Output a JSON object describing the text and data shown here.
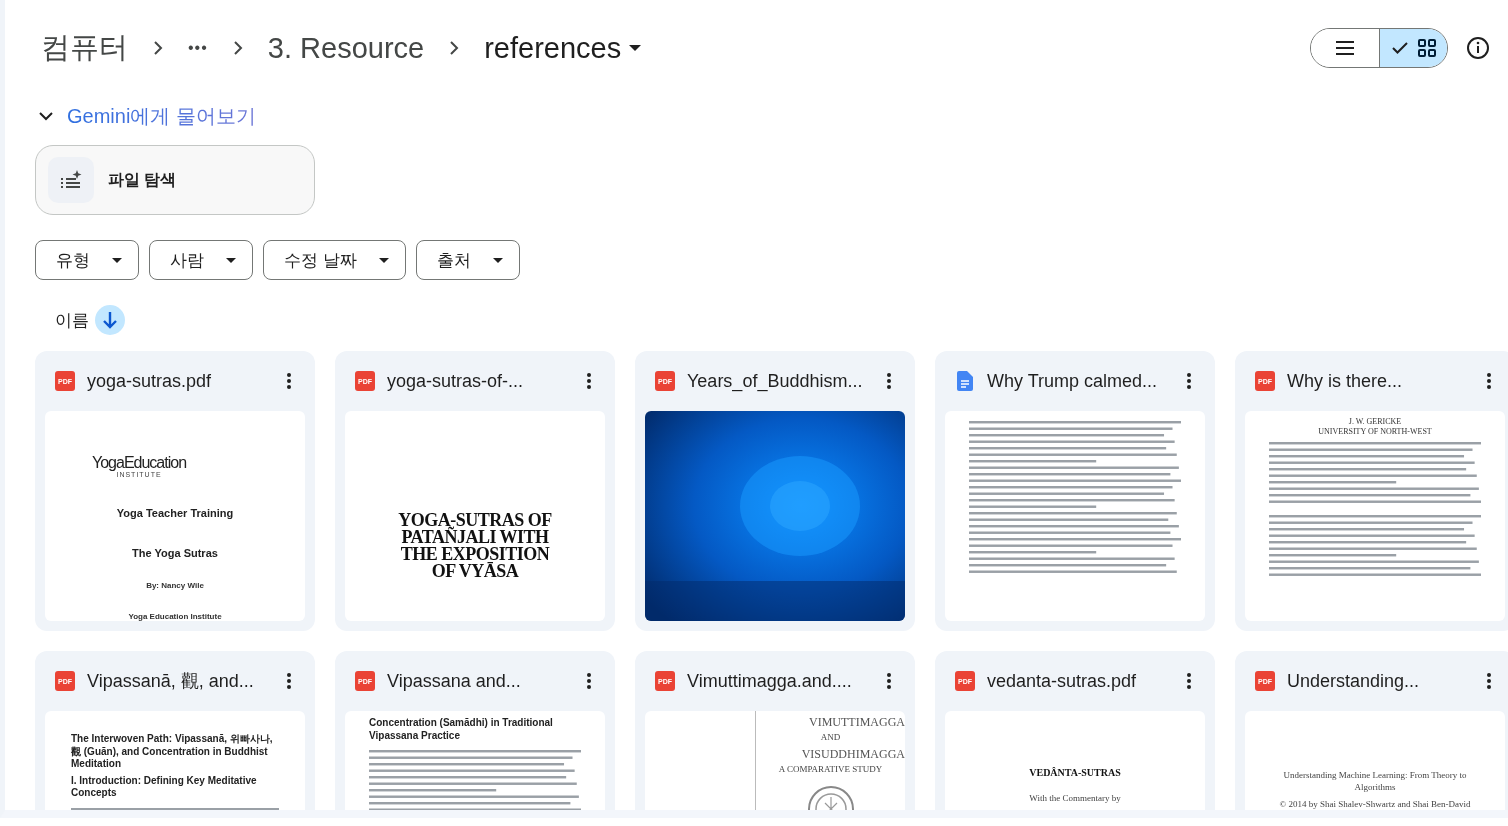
{
  "breadcrumb": [
    {
      "kind": "root",
      "label": "컴퓨터"
    },
    {
      "kind": "more",
      "label": "•••"
    },
    {
      "kind": "folder",
      "label": "3. Resource"
    },
    {
      "kind": "current",
      "label": "references"
    }
  ],
  "view_toggle": [
    {
      "kind": "list",
      "selected": false
    },
    {
      "kind": "grid",
      "selected": true
    }
  ],
  "gemini": {
    "label": "Gemini에게 물어보기",
    "expanded": true,
    "action": "파일 탐색"
  },
  "filters": [
    "유형",
    "사람",
    "수정 날짜",
    "출처"
  ],
  "sort": {
    "label": "이름",
    "descending": true
  },
  "files": [
    {
      "name": "yoga-sutras.pdf",
      "kind": "pdf",
      "type_label": "PDF",
      "preview": {
        "kind": "spread",
        "blocks": [
          {
            "kind": "logo",
            "text": "YogaEducation",
            "sub": "INSTITUTE"
          },
          {
            "kind": "subtitle",
            "text": "Yoga Teacher Training"
          },
          {
            "kind": "subtitle",
            "text": "The Yoga Sutras"
          },
          {
            "kind": "byline",
            "text": "By: Nancy Wile"
          },
          {
            "kind": "byline",
            "text": "Yoga Education Institute"
          }
        ]
      }
    },
    {
      "name": "yoga-sutras-of-...",
      "kind": "pdf",
      "type_label": "PDF",
      "preview": {
        "kind": "middle",
        "blocks": [
          {
            "kind": "serif_title",
            "text": "YOGA-SUTRAS OF PATAÑJALI WITH THE EXPOSITION OF VYĀSA"
          }
        ]
      }
    },
    {
      "name": "Years_of_Buddhism...",
      "kind": "pdf",
      "type_label": "PDF"
    },
    {
      "name": "Why Trump calmed...",
      "kind": "doc",
      "preview": {
        "kind": "top",
        "blocks": [
          {
            "kind": "long_text"
          }
        ]
      }
    },
    {
      "name": "Why is there...",
      "kind": "pdf",
      "type_label": "PDF",
      "preview": {
        "kind": "top",
        "blocks": [
          {
            "kind": "caps",
            "text": "J. W. GERICKE"
          },
          {
            "kind": "caps",
            "text": "UNIVERSITY OF NORTH-WEST"
          },
          {
            "kind": "paragraph"
          },
          {
            "kind": "paragraph"
          }
        ]
      }
    },
    {
      "name": "Vipassanā, 觀, and...",
      "kind": "pdf",
      "type_label": "PDF",
      "preview": {
        "kind": "mid_top",
        "blocks": [
          {
            "kind": "heading",
            "text": "The Interwoven Path: Vipassanā, 위빠사나, 觀 (Guān), and Concentration in Buddhist Meditation"
          },
          {
            "kind": "heading",
            "text": "I. Introduction: Defining Key Meditative Concepts"
          },
          {
            "kind": "paragraph"
          }
        ]
      }
    },
    {
      "name": "Vipassana and...",
      "kind": "pdf",
      "type_label": "PDF",
      "preview": {
        "kind": "top",
        "blocks": [
          {
            "kind": "heading",
            "text": "Concentration (Samādhi) in Traditional Vipassana Practice"
          },
          {
            "kind": "paragraph"
          }
        ]
      }
    },
    {
      "name": "Vimuttimagga.and....",
      "kind": "pdf",
      "type_label": "PDF",
      "preview": {
        "kind": "right",
        "blocks": [
          {
            "kind": "serif_caps",
            "text": "VIMUTTIMAGGA"
          },
          {
            "kind": "tiny",
            "text": "AND"
          },
          {
            "kind": "serif_caps",
            "text": "VISUDDHIMAGGA"
          },
          {
            "kind": "tiny",
            "text": "A COMPARATIVE STUDY"
          },
          {
            "kind": "seal"
          }
        ]
      }
    },
    {
      "name": "vedanta-sutras.pdf",
      "kind": "pdf",
      "type_label": "PDF",
      "preview": {
        "kind": "low",
        "blocks": [
          {
            "kind": "serif_bold",
            "text": "VEDÂNTA-SUTRAS"
          },
          {
            "kind": "tiny",
            "text": "With the Commentary by"
          }
        ]
      }
    },
    {
      "name": "Understanding...",
      "kind": "pdf",
      "type_label": "PDF",
      "preview": {
        "kind": "low",
        "blocks": [
          {
            "kind": "tiny",
            "text": "Understanding Machine Learning: From Theory to Algorithms"
          },
          {
            "kind": "tiny",
            "text": "© 2014 by Shai Shalev-Shwartz and Shai Ben-David"
          }
        ]
      }
    }
  ]
}
